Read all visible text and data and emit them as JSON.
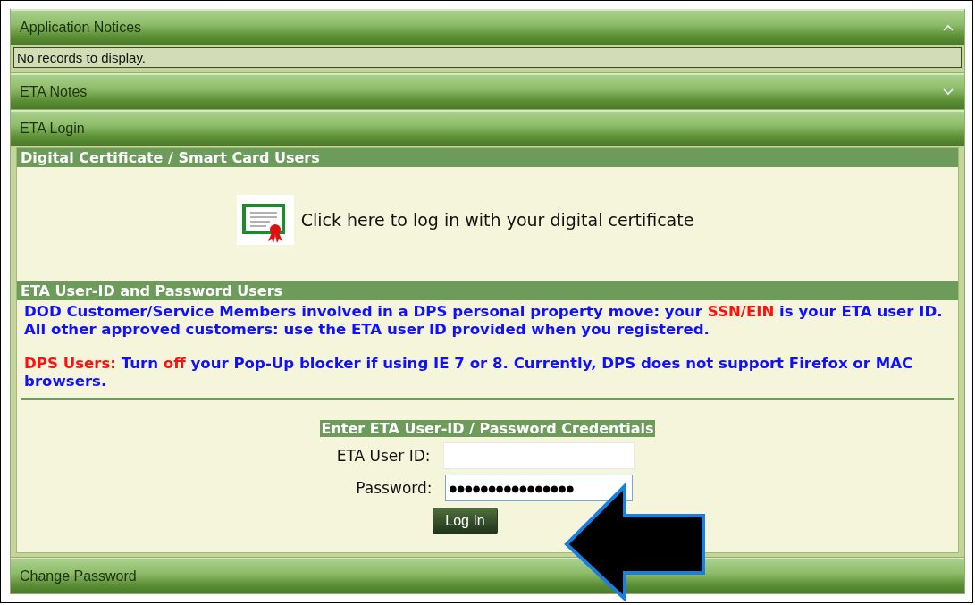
{
  "panels": [
    {
      "title": "Application Notices",
      "expanded": true,
      "kind": "notices",
      "empty_text": "No records to display."
    },
    {
      "title": "ETA Notes",
      "expanded": false,
      "kind": "notes"
    },
    {
      "title": "ETA Login",
      "expanded": true,
      "kind": "login"
    },
    {
      "title": "Change Password",
      "expanded": false,
      "kind": "password"
    }
  ],
  "login": {
    "cert_section": {
      "title": "Digital Certificate / Smart Card Users",
      "link": "Click here to log in with your digital certificate"
    },
    "userid_section": {
      "title": "ETA User-ID and Password Users",
      "paragraphs": [
        [
          {
            "text": "DOD Customer/Service Members involved in a DPS personal property move: your ",
            "alert": false
          },
          {
            "text": "SSN/EIN",
            "alert": true
          },
          {
            "text": " is your ETA user ID. All other approved customers: use the ETA user ID provided when you registered.",
            "alert": false
          }
        ],
        [
          {
            "text": "DPS Users:",
            "alert": true
          },
          {
            "text": " Turn ",
            "alert": false
          },
          {
            "text": "off",
            "alert": true
          },
          {
            "text": " your Pop-Up blocker if using IE 7 or 8. Currently, DPS does not support Firefox or MAC browsers.",
            "alert": false
          }
        ]
      ]
    },
    "form": {
      "title": "Enter ETA User-ID / Password Credentials",
      "fields": [
        {
          "label": "ETA User ID:",
          "kind": "text"
        },
        {
          "label": "Password:",
          "kind": "password",
          "value": "●●●●●●●●●●●●●●●●"
        }
      ],
      "button": "Log In"
    }
  }
}
